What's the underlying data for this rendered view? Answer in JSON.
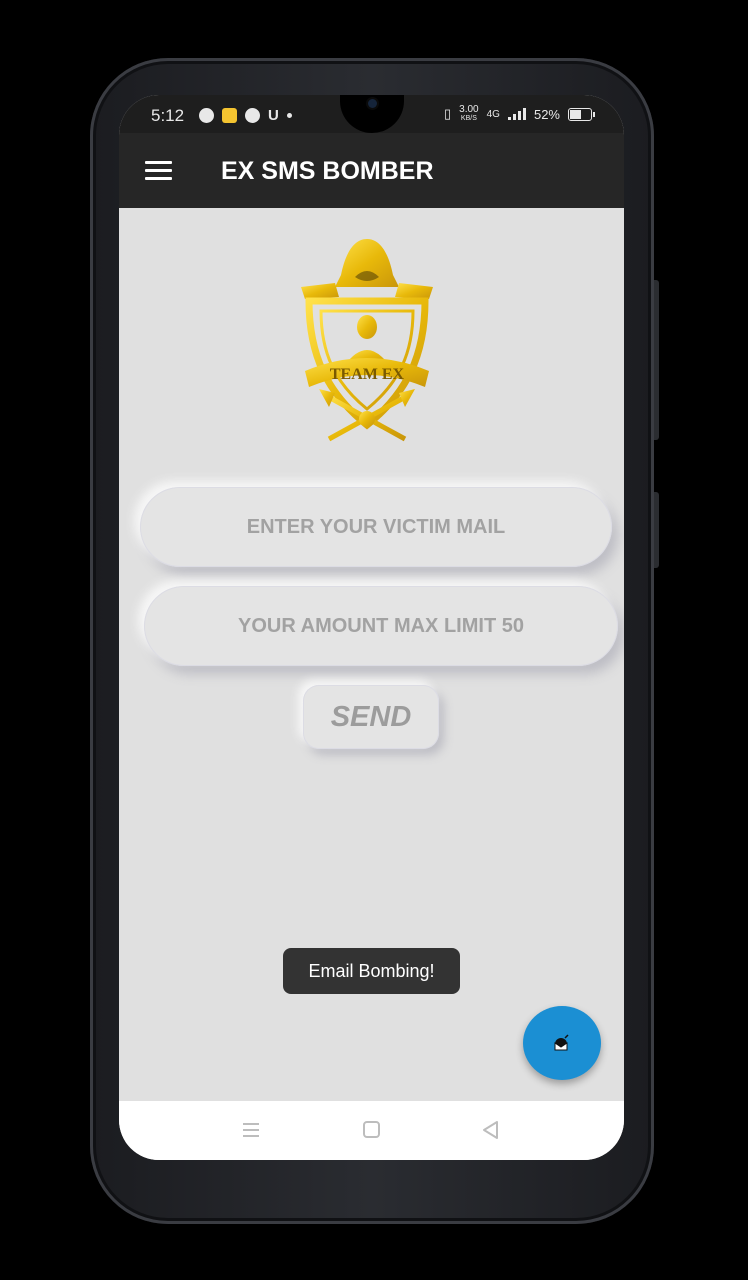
{
  "status_bar": {
    "time": "5:12",
    "net_speed_value": "3.00",
    "net_speed_unit": "KB/S",
    "network_type": "4G",
    "battery": "52%"
  },
  "app_bar": {
    "title": "EX SMS BOMBER",
    "menu_icon": "hamburger-menu-icon"
  },
  "logo": {
    "text": "TEAM EX",
    "color": "#f2c81e"
  },
  "form": {
    "email_placeholder": "ENTER YOUR VICTIM MAIL",
    "email_value": "",
    "amount_placeholder": "YOUR AMOUNT MAX LIMIT 50",
    "amount_value": "",
    "send_label": "SEND"
  },
  "toast": {
    "message": "Email Bombing!"
  },
  "fab": {
    "icon": "email-bomb-icon",
    "color": "#1b8fd3"
  },
  "nav_bar": {
    "icons": [
      "menu-icon",
      "home-square-icon",
      "back-triangle-icon"
    ]
  }
}
